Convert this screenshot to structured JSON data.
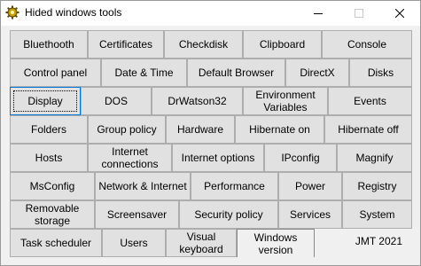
{
  "window": {
    "title": "Hided windows tools",
    "footer": "JMT 2021"
  },
  "rows": [
    [
      "Bluethooth",
      "Certificates",
      "Checkdisk",
      "Clipboard",
      "Console"
    ],
    [
      "Control panel",
      "Date & Time",
      "Default Browser",
      "DirectX",
      "Disks"
    ],
    [
      "Display",
      "DOS",
      "DrWatson32",
      "Environment\nVariables",
      "Events"
    ],
    [
      "Folders",
      "Group policy",
      "Hardware",
      "Hibernate on",
      "Hibernate  off"
    ],
    [
      "Hosts",
      "Internet\nconnections",
      "Internet options",
      "IPconfig",
      "Magnify"
    ],
    [
      "MsConfig",
      "Network & Internet",
      "Performance",
      "Power",
      "Registry"
    ],
    [
      "Removable\nstorage",
      "Screensaver",
      "Security policy",
      "Services",
      "System"
    ],
    [
      "Task scheduler",
      "Users",
      "Visual\nkeyboard",
      "Windows\nversion"
    ]
  ]
}
